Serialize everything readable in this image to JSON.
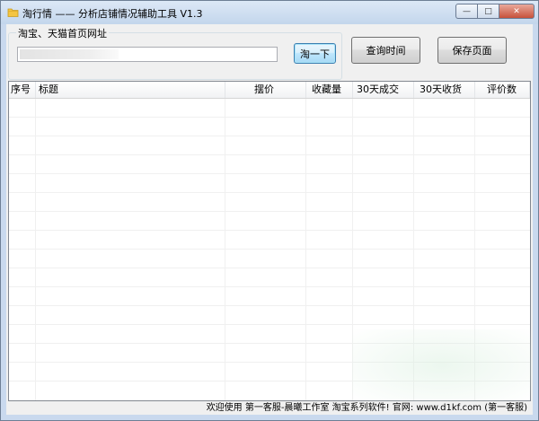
{
  "window": {
    "title": "淘行情 —— 分析店铺情况辅助工具 V1.3",
    "app_icon": "folder-icon",
    "controls": {
      "minimize": "—",
      "maximize": "□",
      "close": "✕"
    },
    "accent": "#c9d9ee"
  },
  "url_group": {
    "label": "淘宝、天猫首页网址",
    "url_value": "",
    "search_button": "淘一下"
  },
  "toolbar": {
    "query_time_button": "查询时间",
    "save_page_button": "保存页面"
  },
  "table": {
    "columns": [
      "序号",
      "标题",
      "摆价",
      "收藏量",
      "30天成交",
      "30天收货",
      "评价数"
    ],
    "rows": []
  },
  "status": {
    "text": "欢迎使用 第一客服-晨曦工作室 淘宝系列软件! 官网: www.d1kf.com (第一客服)"
  }
}
